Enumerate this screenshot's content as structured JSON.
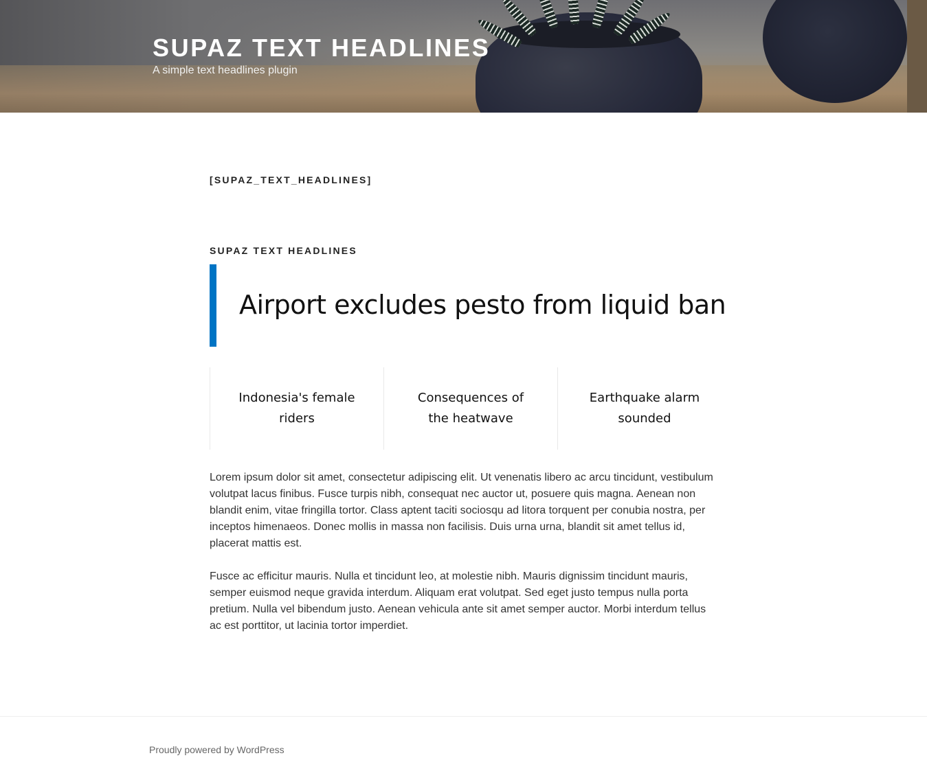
{
  "header": {
    "site_title": "SUPAZ TEXT HEADLINES",
    "site_description": "A simple text headlines plugin"
  },
  "main": {
    "shortcode_label": "[SUPAZ_TEXT_HEADLINES]",
    "widget_title": "SUPAZ TEXT HEADLINES",
    "featured_headline": "Airport excludes pesto from liquid ban",
    "featured_border_color": "#0074c4",
    "sub_headlines": [
      {
        "text": "Indonesia's female riders"
      },
      {
        "text": "Consequences of the heatwave"
      },
      {
        "text": "Earthquake alarm sounded"
      }
    ],
    "paragraphs": [
      "Lorem ipsum dolor sit amet, consectetur adipiscing elit. Ut venenatis libero ac arcu tincidunt, vestibulum volutpat lacus finibus. Fusce turpis nibh, consequat nec auctor ut, posuere quis magna. Aenean non blandit enim, vitae fringilla tortor. Class aptent taciti sociosqu ad litora torquent per conubia nostra, per inceptos himenaeos. Donec mollis in massa non facilisis. Duis urna urna, blandit sit amet tellus id, placerat mattis est.",
      "Fusce ac efficitur mauris. Nulla et tincidunt leo, at molestie nibh. Mauris dignissim tincidunt mauris, semper euismod neque gravida interdum. Aliquam erat volutpat. Sed eget justo tempus nulla porta pretium. Nulla vel bibendum justo. Aenean vehicula ante sit amet semper auctor. Morbi interdum tellus ac est porttitor, ut lacinia tortor imperdiet."
    ]
  },
  "footer": {
    "credit": "Proudly powered by WordPress"
  }
}
